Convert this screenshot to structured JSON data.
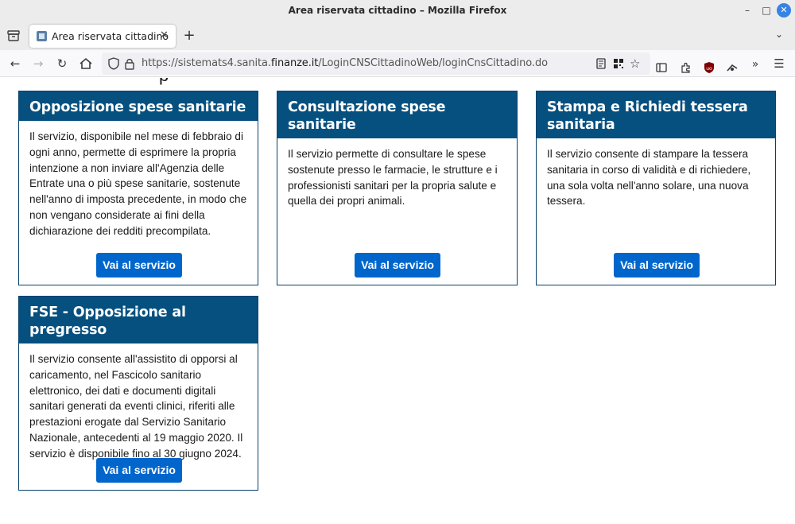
{
  "window": {
    "title": "Area riservata cittadino – Mozilla Firefox"
  },
  "tabs": [
    {
      "label": "Area riservata cittadino"
    }
  ],
  "navbar": {
    "url_prefix": "https://sistemats4.sanita.",
    "url_domain": "finanze.it",
    "url_path": "/LoginCNSCittadinoWeb/loginCnsCittadino.do"
  },
  "page": {
    "heading_fragment": "p",
    "cards": [
      {
        "title": "Opposizione spese sanitarie",
        "body": "Il servizio, disponibile nel mese di febbraio di ogni anno, permette di esprimere la propria intenzione a non inviare all'Agenzia delle Entrate una o più spese sanitarie, sostenute nell'anno di imposta precedente, in modo che non vengano considerate ai fini della dichiarazione dei redditi precompilata.",
        "button": "Vai al servizio"
      },
      {
        "title": "Consultazione spese sanitarie",
        "body": "Il servizio permette di consultare le spese sostenute presso le farmacie, le strutture e i professionisti sanitari per la propria salute e quella dei propri animali.",
        "button": "Vai al servizio"
      },
      {
        "title": "Stampa e Richiedi tessera sanitaria",
        "body": "Il servizio consente di stampare la tessera sanitaria in corso di validità e di richiedere, una sola volta nell'anno solare, una nuova tessera.",
        "button": "Vai al servizio"
      },
      {
        "title": "FSE - Opposizione al pregresso",
        "body": "Il servizio consente all'assistito di opporsi al caricamento, nel Fascicolo sanitario elettronico, dei dati e documenti digitali sanitari generati da eventi clinici, riferiti alle prestazioni erogate dal Servizio Sanitario Nazionale, antecedenti al 19 maggio 2020. Il servizio è disponibile fino al 30 giugno 2024.",
        "button": "Vai al servizio"
      }
    ]
  },
  "colors": {
    "card_header": "#06507f",
    "button": "#0066cc",
    "window_close": "#3584e4"
  }
}
